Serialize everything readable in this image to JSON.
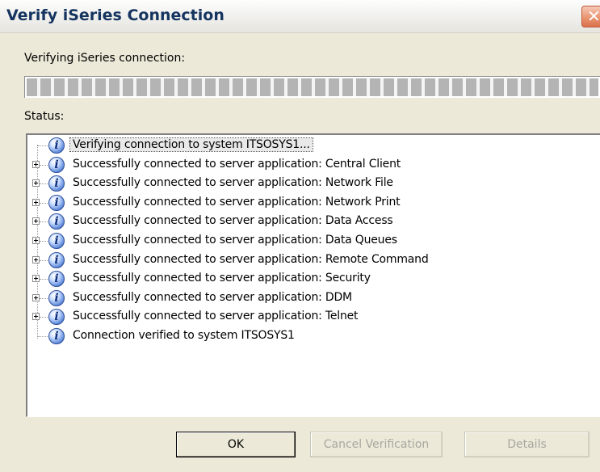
{
  "window": {
    "title": "Verify iSeries Connection",
    "close_glyph": "✕"
  },
  "progress": {
    "label": "Verifying iSeries connection:",
    "value": 1.0
  },
  "status": {
    "label": "Status:",
    "items": [
      {
        "text": "Verifying connection to system ITSOSYS1...",
        "expandable": false,
        "icon": "info-icon"
      },
      {
        "text": "Successfully connected to server application: Central Client",
        "expandable": true,
        "icon": "info-icon"
      },
      {
        "text": "Successfully connected to server application: Network File",
        "expandable": true,
        "icon": "info-icon"
      },
      {
        "text": "Successfully connected to server application: Network Print",
        "expandable": true,
        "icon": "info-icon"
      },
      {
        "text": "Successfully connected to server application: Data Access",
        "expandable": true,
        "icon": "info-icon"
      },
      {
        "text": "Successfully connected to server application: Data Queues",
        "expandable": true,
        "icon": "info-icon"
      },
      {
        "text": "Successfully connected to server application: Remote Command",
        "expandable": true,
        "icon": "info-icon"
      },
      {
        "text": "Successfully connected to server application: Security",
        "expandable": true,
        "icon": "info-icon"
      },
      {
        "text": "Successfully connected to server application: DDM",
        "expandable": true,
        "icon": "info-icon"
      },
      {
        "text": "Successfully connected to server application: Telnet",
        "expandable": true,
        "icon": "info-icon"
      },
      {
        "text": "Connection verified to system ITSOSYS1",
        "expandable": false,
        "icon": "info-icon"
      }
    ]
  },
  "buttons": {
    "ok": "OK",
    "cancel": "Cancel Verification",
    "details": "Details"
  }
}
